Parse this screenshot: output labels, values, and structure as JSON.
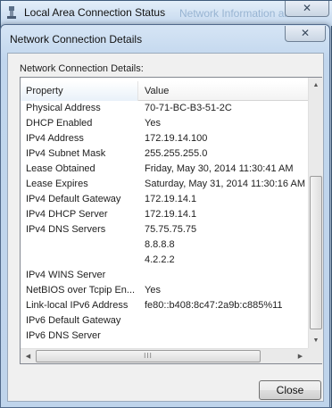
{
  "parent_window": {
    "title": "Local Area Connection Status",
    "ghost_text": "Network Information and",
    "close_glyph": "✕"
  },
  "dialog": {
    "title": "Network Connection Details",
    "close_glyph": "✕",
    "group_label": "Network Connection Details:",
    "columns": {
      "property": "Property",
      "value": "Value"
    },
    "rows": [
      {
        "property": "Physical Address",
        "value": "70-71-BC-B3-51-2C"
      },
      {
        "property": "DHCP Enabled",
        "value": "Yes"
      },
      {
        "property": "IPv4 Address",
        "value": "172.19.14.100"
      },
      {
        "property": "IPv4 Subnet Mask",
        "value": "255.255.255.0"
      },
      {
        "property": "Lease Obtained",
        "value": "Friday, May 30, 2014 11:30:41 AM"
      },
      {
        "property": "Lease Expires",
        "value": "Saturday, May 31, 2014 11:30:16 AM"
      },
      {
        "property": "IPv4 Default Gateway",
        "value": "172.19.14.1"
      },
      {
        "property": "IPv4 DHCP Server",
        "value": "172.19.14.1"
      },
      {
        "property": "IPv4 DNS Servers",
        "value": "75.75.75.75"
      },
      {
        "property": "",
        "value": "8.8.8.8"
      },
      {
        "property": "",
        "value": "4.2.2.2"
      },
      {
        "property": "IPv4 WINS Server",
        "value": ""
      },
      {
        "property": "NetBIOS over Tcpip En...",
        "value": "Yes"
      },
      {
        "property": "Link-local IPv6 Address",
        "value": "fe80::b408:8c47:2a9b:c885%11"
      },
      {
        "property": "IPv6 Default Gateway",
        "value": ""
      },
      {
        "property": "IPv6 DNS Server",
        "value": ""
      }
    ],
    "scrollbar": {
      "up_glyph": "▲",
      "down_glyph": "▼",
      "left_glyph": "◀",
      "right_glyph": "▶",
      "grip_glyph": "III"
    },
    "close_button_label": "Close"
  },
  "colors": {
    "titlebar": "#c4d8ee",
    "list_background": "#ffffff",
    "dialog_body": "#f0f0f0"
  }
}
